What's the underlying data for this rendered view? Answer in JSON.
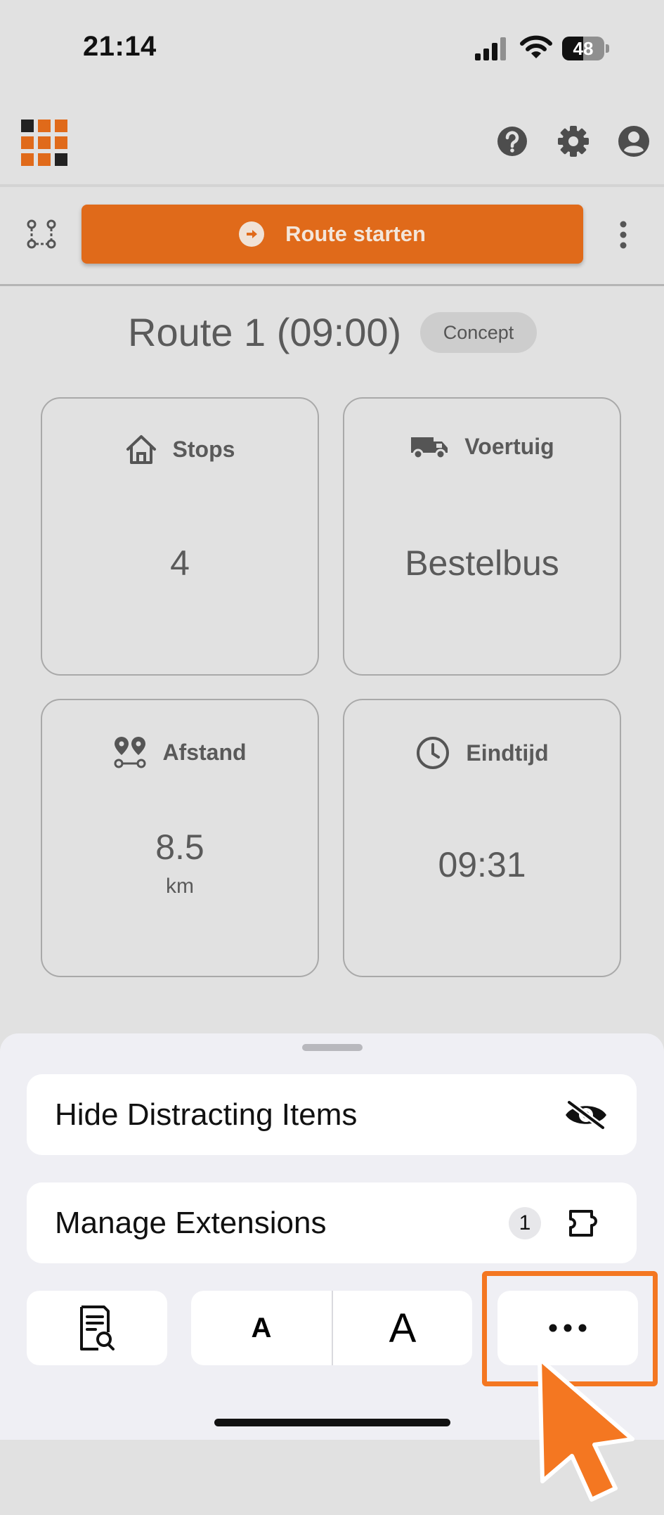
{
  "status_bar": {
    "time": "21:14",
    "battery": "48"
  },
  "toolbar": {
    "start_route_label": "Route starten"
  },
  "route": {
    "title": "Route 1 (09:00)",
    "status": "Concept"
  },
  "stats": {
    "stops": {
      "label": "Stops",
      "value": "4"
    },
    "vehicle": {
      "label": "Voertuig",
      "value": "Bestelbus"
    },
    "distance": {
      "label": "Afstand",
      "value": "8.5",
      "unit": "km"
    },
    "end_time": {
      "label": "Eindtijd",
      "value": "09:31"
    }
  },
  "sheet": {
    "hide_items_label": "Hide Distracting Items",
    "manage_extensions_label": "Manage Extensions",
    "extensions_count": "1",
    "font_small_label": "A",
    "font_large_label": "A"
  },
  "colors": {
    "brand_orange": "#e06a1a",
    "highlight_orange": "#f47721"
  }
}
